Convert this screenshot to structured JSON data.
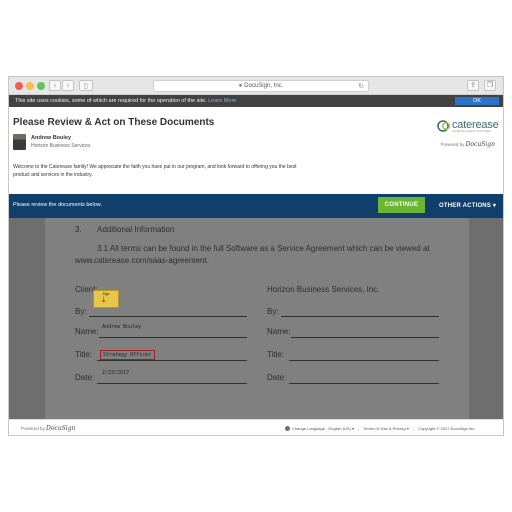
{
  "browser": {
    "url": "DocuSign, Inc."
  },
  "cookie_bar": {
    "message": "This site uses cookies, some of which are required for the operation of the site.",
    "link": "Learn More",
    "ok_label": "OK"
  },
  "header": {
    "title": "Please Review & Act on These Documents",
    "sender_name": "Andrew Bouley",
    "sender_company": "Horizon Business Services",
    "welcome": "Welcome to the Caterease family! We appreciate the faith you have put in our program, and look forward to offering you the best product and services in the industry.",
    "logo_text": "caterease",
    "logo_tagline": "CATERING & EVENT SOFTWARE",
    "powered_by": "Powered by",
    "docusign": "DocuSign"
  },
  "action_bar": {
    "message": "Please review the documents below.",
    "continue_label": "CONTINUE",
    "other_actions_label": "OTHER ACTIONS ▾"
  },
  "document": {
    "section_number": "3.",
    "section_title": "Additional Information",
    "clause": "3.1     All terms can be found in the full Software as a Service Agreement which can be viewed at",
    "clause_link": "www.caterease.com/saas-agreement.",
    "left_party": "Client:",
    "right_party": "Horizon Business Services, Inc.",
    "by_label": "By:",
    "name_label": "Name:",
    "title_label": "Title:",
    "date_label": "Date:",
    "sign_tag": "Sign",
    "typed_name": "Andrew Bouley",
    "typed_title": "Strategy Officer",
    "typed_date": "2/23/2017"
  },
  "footer": {
    "powered_by": "Powered by",
    "docusign": "DocuSign",
    "language": "Change Language - English (US)",
    "terms": "Terms Of Use & Privacy",
    "copyright": "Copyright © 2017 DocuSign Inc."
  }
}
